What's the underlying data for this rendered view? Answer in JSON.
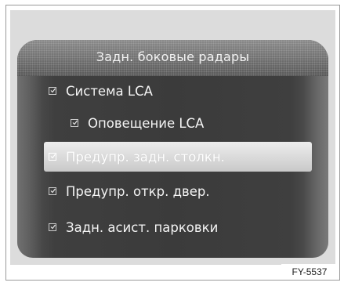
{
  "menu": {
    "title": "Задн. боковые радары",
    "items": [
      {
        "label": "Система LCA",
        "checked": true,
        "level": 0,
        "highlighted": false
      },
      {
        "label": "Оповещение LCA",
        "checked": true,
        "level": 1,
        "highlighted": false
      },
      {
        "label": "Предупр. задн. столкн.",
        "checked": true,
        "level": 0,
        "highlighted": true
      },
      {
        "label": "Предупр. откр. двер.",
        "checked": true,
        "level": 0,
        "highlighted": false
      },
      {
        "label": "Задн. асист. парковки",
        "checked": true,
        "level": 0,
        "highlighted": false
      }
    ]
  },
  "figure_code": "FY-5537",
  "colors": {
    "screen_bg": "#3b3b3b",
    "highlight": "#e0e0e0",
    "text": "#f4f4f4"
  }
}
